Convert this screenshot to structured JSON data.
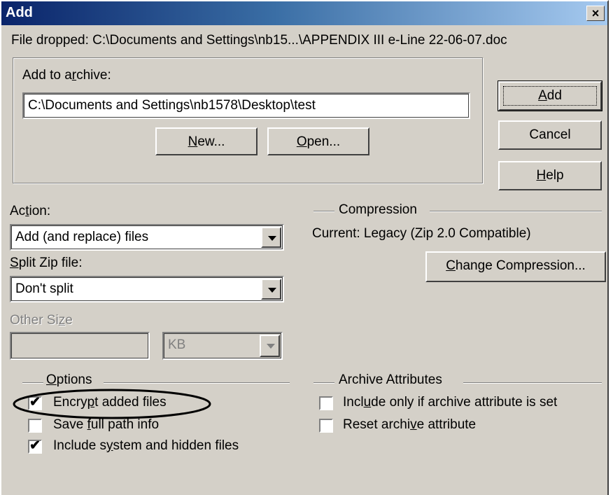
{
  "window": {
    "title": "Add",
    "close_glyph": "×"
  },
  "file_dropped": "File dropped: C:\\Documents and Settings\\nb15...\\APPENDIX III e-Line 22-06-07.doc",
  "archive": {
    "label_pre": "Add to a",
    "label_key": "r",
    "label_post": "chive:",
    "path": "C:\\Documents and Settings\\nb1578\\Desktop\\test",
    "new_key": "N",
    "new_rest": "ew...",
    "open_key": "O",
    "open_rest": "pen..."
  },
  "buttons": {
    "add_key": "A",
    "add_rest": "dd",
    "cancel": "Cancel",
    "help_key": "H",
    "help_rest": "elp"
  },
  "action": {
    "label_pre": "Ac",
    "label_key": "t",
    "label_post": "ion:",
    "value": "Add (and replace) files"
  },
  "split": {
    "label_key": "S",
    "label_post": "plit Zip file:",
    "value": "Don't split"
  },
  "other_size": {
    "label_pre": "Other Si",
    "label_key": "z",
    "label_post": "e",
    "unit": "KB"
  },
  "compression": {
    "heading": "Compression",
    "current": "Current: Legacy (Zip 2.0 Compatible)",
    "change_key": "C",
    "change_rest": "hange Compression..."
  },
  "options": {
    "heading_key": "O",
    "heading_rest": "ptions",
    "items": [
      {
        "pre": "Encry",
        "key": "p",
        "post": "t added files",
        "checked": true
      },
      {
        "pre": "Save ",
        "key": "f",
        "post": "ull path info",
        "checked": false
      },
      {
        "pre": "Include s",
        "key": "y",
        "post": "stem and hidden files",
        "checked": true
      }
    ]
  },
  "archive_attributes": {
    "heading": "Archive Attributes",
    "items": [
      {
        "pre": "Incl",
        "key": "u",
        "post": "de only if archive attribute is set",
        "checked": false
      },
      {
        "pre": "Reset archi",
        "key": "v",
        "post": "e attribute",
        "checked": false
      }
    ]
  },
  "check_glyph": "✔",
  "colors": {
    "title_start": "#0a246a",
    "title_end": "#a6caf0",
    "face": "#d4d0c8"
  }
}
